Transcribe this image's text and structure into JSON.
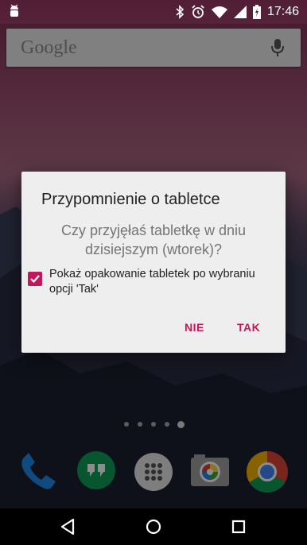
{
  "status_bar": {
    "time": "17:46",
    "icons": [
      "android-debug-icon",
      "bluetooth-icon",
      "alarm-icon",
      "wifi-icon",
      "signal-icon",
      "battery-icon"
    ]
  },
  "search_bar": {
    "logo_text": "Google",
    "icon": "mic-icon"
  },
  "dialog": {
    "title": "Przypomnienie o tabletce",
    "message": "Czy przyjęłaś tabletkę w dniu dzisiejszym (wtorek)?",
    "checkbox_label": "Pokaż opakowanie tabletek po wybraniu opcji 'Tak'",
    "checkbox_checked": true,
    "button_no": "NIE",
    "button_yes": "TAK",
    "accent_color": "#c2185b"
  },
  "home_screen": {
    "page_count": 5,
    "active_page": 5,
    "dock": [
      "phone-icon",
      "hangouts-icon",
      "app-drawer-icon",
      "camera-icon",
      "chrome-icon"
    ]
  },
  "nav_bar": [
    "back-icon",
    "home-icon",
    "recents-icon"
  ]
}
